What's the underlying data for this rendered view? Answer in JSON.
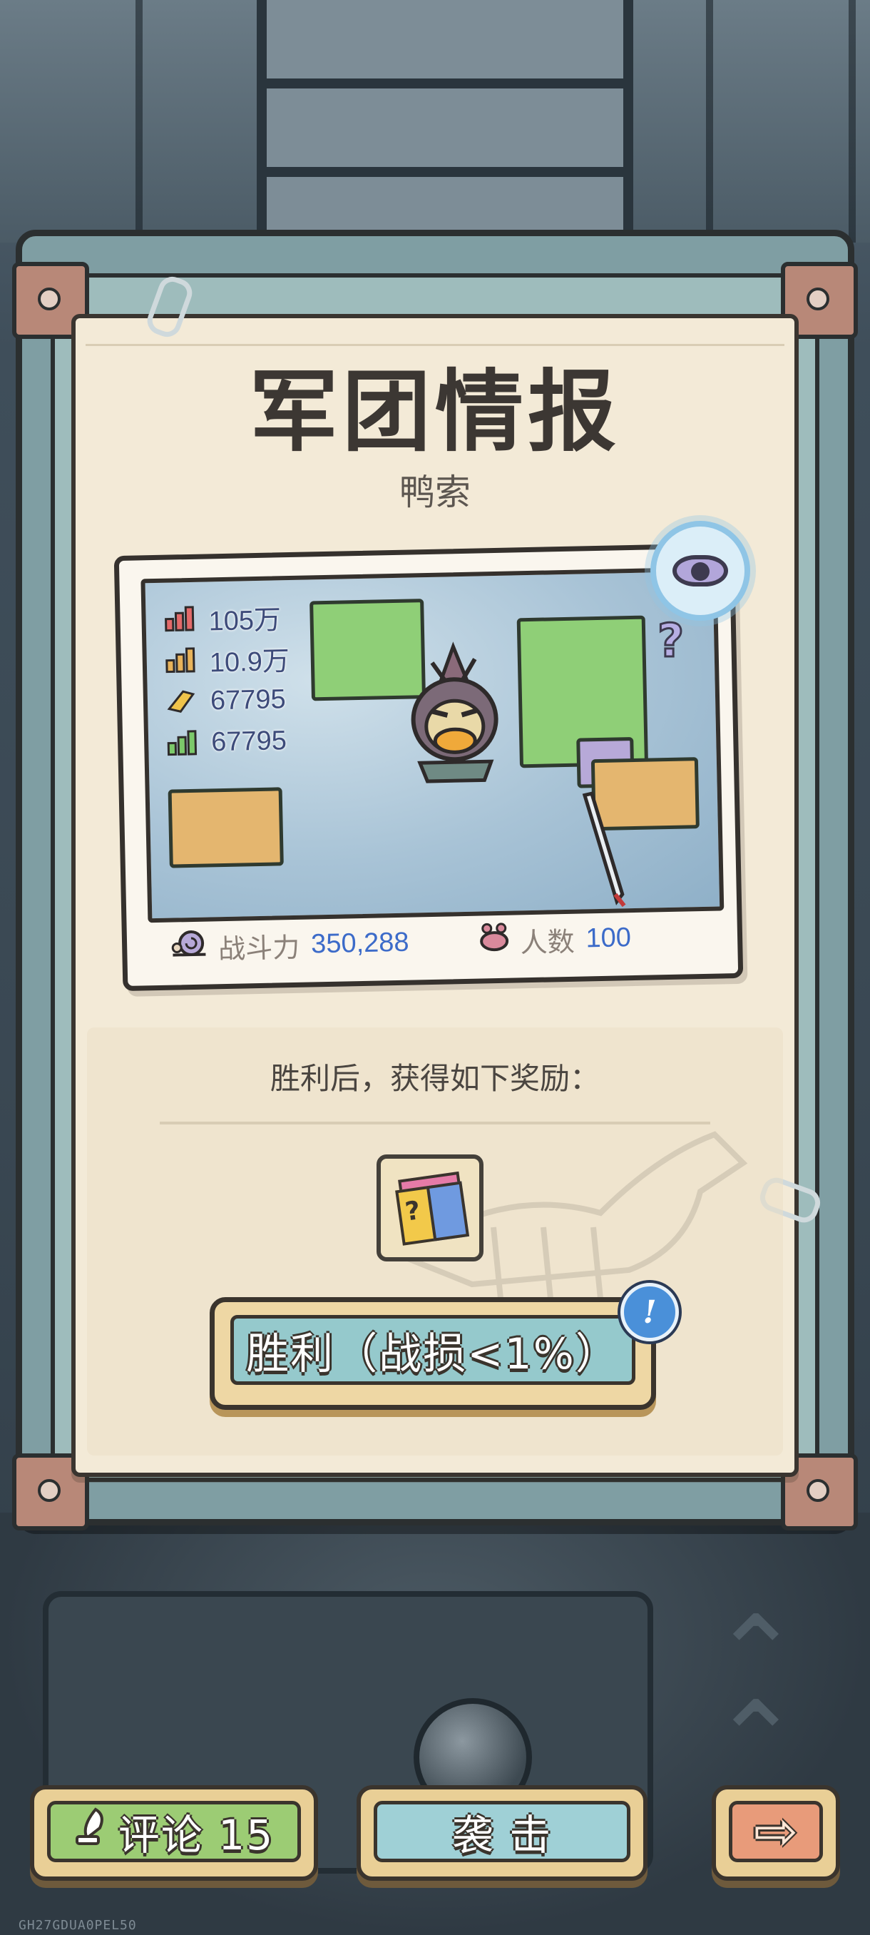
{
  "panel": {
    "title": "军团情报",
    "enemy_name": "鸭索"
  },
  "card": {
    "stats": [
      {
        "icon": "attack-stat-icon",
        "value": "105万"
      },
      {
        "icon": "defense-stat-icon",
        "value": "10.9万"
      },
      {
        "icon": "speed-stat-icon",
        "value": "67795"
      },
      {
        "icon": "health-stat-icon",
        "value": "67795"
      }
    ],
    "power_label": "战斗力",
    "power_value": "350,288",
    "count_label": "人数",
    "count_value": "100"
  },
  "rewards": {
    "title": "胜利后，获得如下奖励：",
    "item_icon": "mystery-cube-icon",
    "item_mark": "?"
  },
  "outcome_button": {
    "label": "胜利（战损<1%）",
    "info_glyph": "!"
  },
  "bottom_bar": {
    "comment_label": "评论 15",
    "attack_label": "袭 击",
    "next_glyph": "⇨"
  },
  "footer_code": "GH27GDUA0PEL50",
  "colors": {
    "stat_value": "#3d4b7a",
    "power_value": "#3c6bc9",
    "paper": "#f3ead7",
    "frame": "#7f9ea3"
  }
}
